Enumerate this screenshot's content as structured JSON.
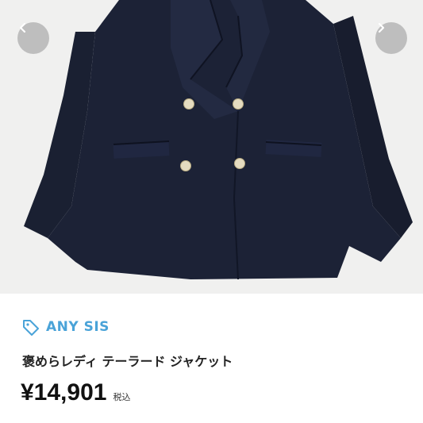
{
  "product": {
    "brand": "ANY SIS",
    "title": "褒めらレディ テーラード ジャケット",
    "price": "¥14,901",
    "tax_label": "税込"
  },
  "gallery": {
    "prev_icon": "chevron-left-icon",
    "next_icon": "chevron-right-icon"
  },
  "colors": {
    "brand": "#4aa3d8",
    "jacket": "#1c2236",
    "background": "#f0f0ef"
  }
}
